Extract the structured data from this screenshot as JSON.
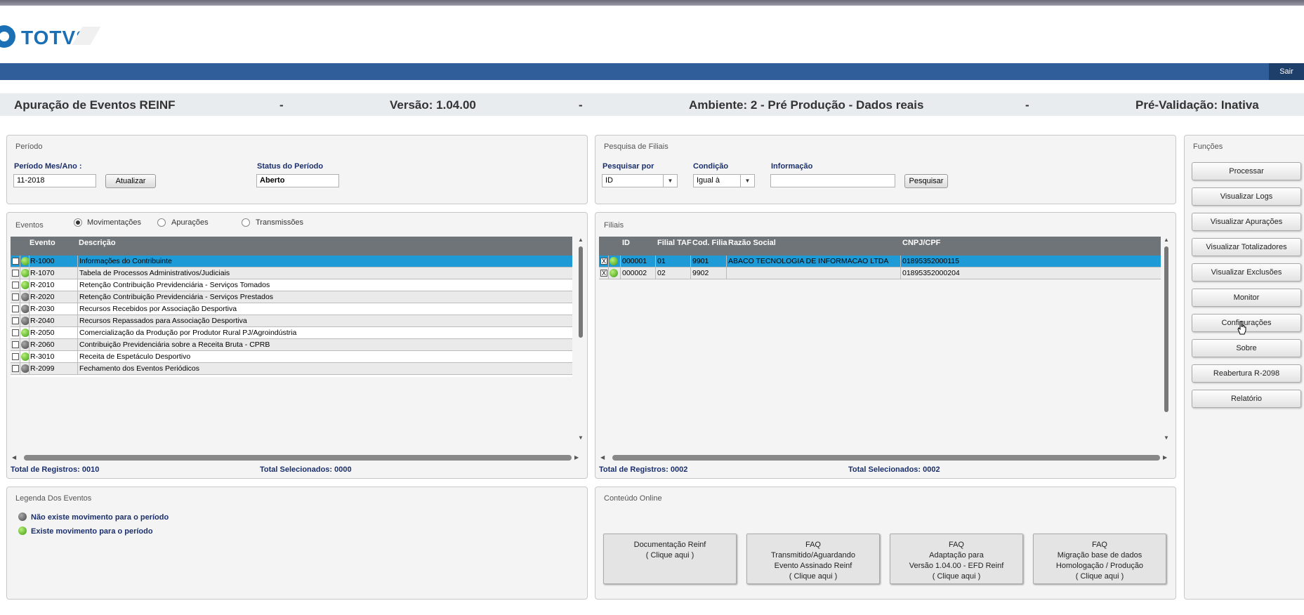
{
  "brand": {
    "name": "TOTVS"
  },
  "topbar": {
    "logout_label": "Sair"
  },
  "header": {
    "title": "Apuração de Eventos REINF",
    "sep": "-",
    "version": "Versão: 1.04.00",
    "environment": "Ambiente: 2 - Pré Produção - Dados reais",
    "prevalidation": "Pré-Validação: Inativa"
  },
  "periodo": {
    "title": "Período",
    "month_label": "Período Mes/Ano :",
    "month_value": "11-2018",
    "update_button": "Atualizar",
    "status_label": "Status do Período",
    "status_value": "Aberto"
  },
  "pesquisa": {
    "title": "Pesquisa de Filiais",
    "search_by_label": "Pesquisar por",
    "search_by_value": "ID",
    "condition_label": "Condição",
    "condition_value": "Igual à",
    "info_label": "Informação",
    "info_value": "",
    "search_button": "Pesquisar"
  },
  "eventos": {
    "title": "Eventos",
    "radios": [
      "Movimentações",
      "Apurações",
      "Transmissões"
    ],
    "selected_radio": "Movimentações",
    "columns": [
      "Evento",
      "Descrição"
    ],
    "rows": [
      {
        "code": "R-1000",
        "desc": "Informações do Contribuinte",
        "status": "green"
      },
      {
        "code": "R-1070",
        "desc": "Tabela de Processos Administrativos/Judiciais",
        "status": "green"
      },
      {
        "code": "R-2010",
        "desc": "Retenção Contribuição Previdenciária - Serviços Tomados",
        "status": "green"
      },
      {
        "code": "R-2020",
        "desc": "Retenção Contribuição Previdenciária - Serviços Prestados",
        "status": "gray"
      },
      {
        "code": "R-2030",
        "desc": "Recursos Recebidos por Associação Desportiva",
        "status": "gray"
      },
      {
        "code": "R-2040",
        "desc": "Recursos Repassados para Associação Desportiva",
        "status": "gray"
      },
      {
        "code": "R-2050",
        "desc": "Comercialização da Produção por Produtor Rural PJ/Agroindústria",
        "status": "green"
      },
      {
        "code": "R-2060",
        "desc": "Contribuição Previdenciária sobre a Receita Bruta - CPRB",
        "status": "gray"
      },
      {
        "code": "R-3010",
        "desc": "Receita de Espetáculo Desportivo",
        "status": "green"
      },
      {
        "code": "R-2099",
        "desc": "Fechamento dos Eventos Periódicos",
        "status": "gray"
      }
    ],
    "total_registros": "Total de Registros: 0010",
    "total_selecionados": "Total Selecionados: 0000"
  },
  "filiais": {
    "title": "Filiais",
    "columns": [
      "ID",
      "Filial TAF",
      "Cod. Filial",
      "Razão Social",
      "CNPJ/CPF"
    ],
    "rows": [
      {
        "id": "000001",
        "filial_taf": "01",
        "cod_filial": "9901",
        "razao": "ABACO TECNOLOGIA DE INFORMACAO LTDA",
        "cnpj": "01895352000115",
        "checked": "X"
      },
      {
        "id": "000002",
        "filial_taf": "02",
        "cod_filial": "9902",
        "razao": "",
        "cnpj": "01895352000204",
        "checked": "X"
      }
    ],
    "total_registros": "Total de Registros: 0002",
    "total_selecionados": "Total Selecionados: 0002"
  },
  "funcoes": {
    "title": "Funções",
    "buttons": [
      "Processar",
      "Visualizar Logs",
      "Visualizar Apurações",
      "Visualizar Totalizadores",
      "Visualizar Exclusões",
      "Monitor",
      "Configurações",
      "Sobre",
      "Reabertura R-2098",
      "Relatório"
    ]
  },
  "legenda": {
    "title": "Legenda Dos Eventos",
    "items": [
      "Não existe movimento para o período",
      "Existe movimento para o período"
    ]
  },
  "conteudo": {
    "title": "Conteúdo Online",
    "cards": [
      {
        "l1": "",
        "l2": "Documentação Reinf",
        "l3": "( Clique aqui )",
        "l4": ""
      },
      {
        "l1": "FAQ",
        "l2": "Transmitido/Aguardando",
        "l3": "Evento Assinado Reinf",
        "l4": "( Clique aqui )"
      },
      {
        "l1": "FAQ",
        "l2": "Adaptação para",
        "l3": "Versão 1.04.00 - EFD Reinf",
        "l4": "( Clique aqui )"
      },
      {
        "l1": "FAQ",
        "l2": "Migração base de dados",
        "l3": "Homologação / Produção",
        "l4": "( Clique aqui )"
      }
    ]
  }
}
